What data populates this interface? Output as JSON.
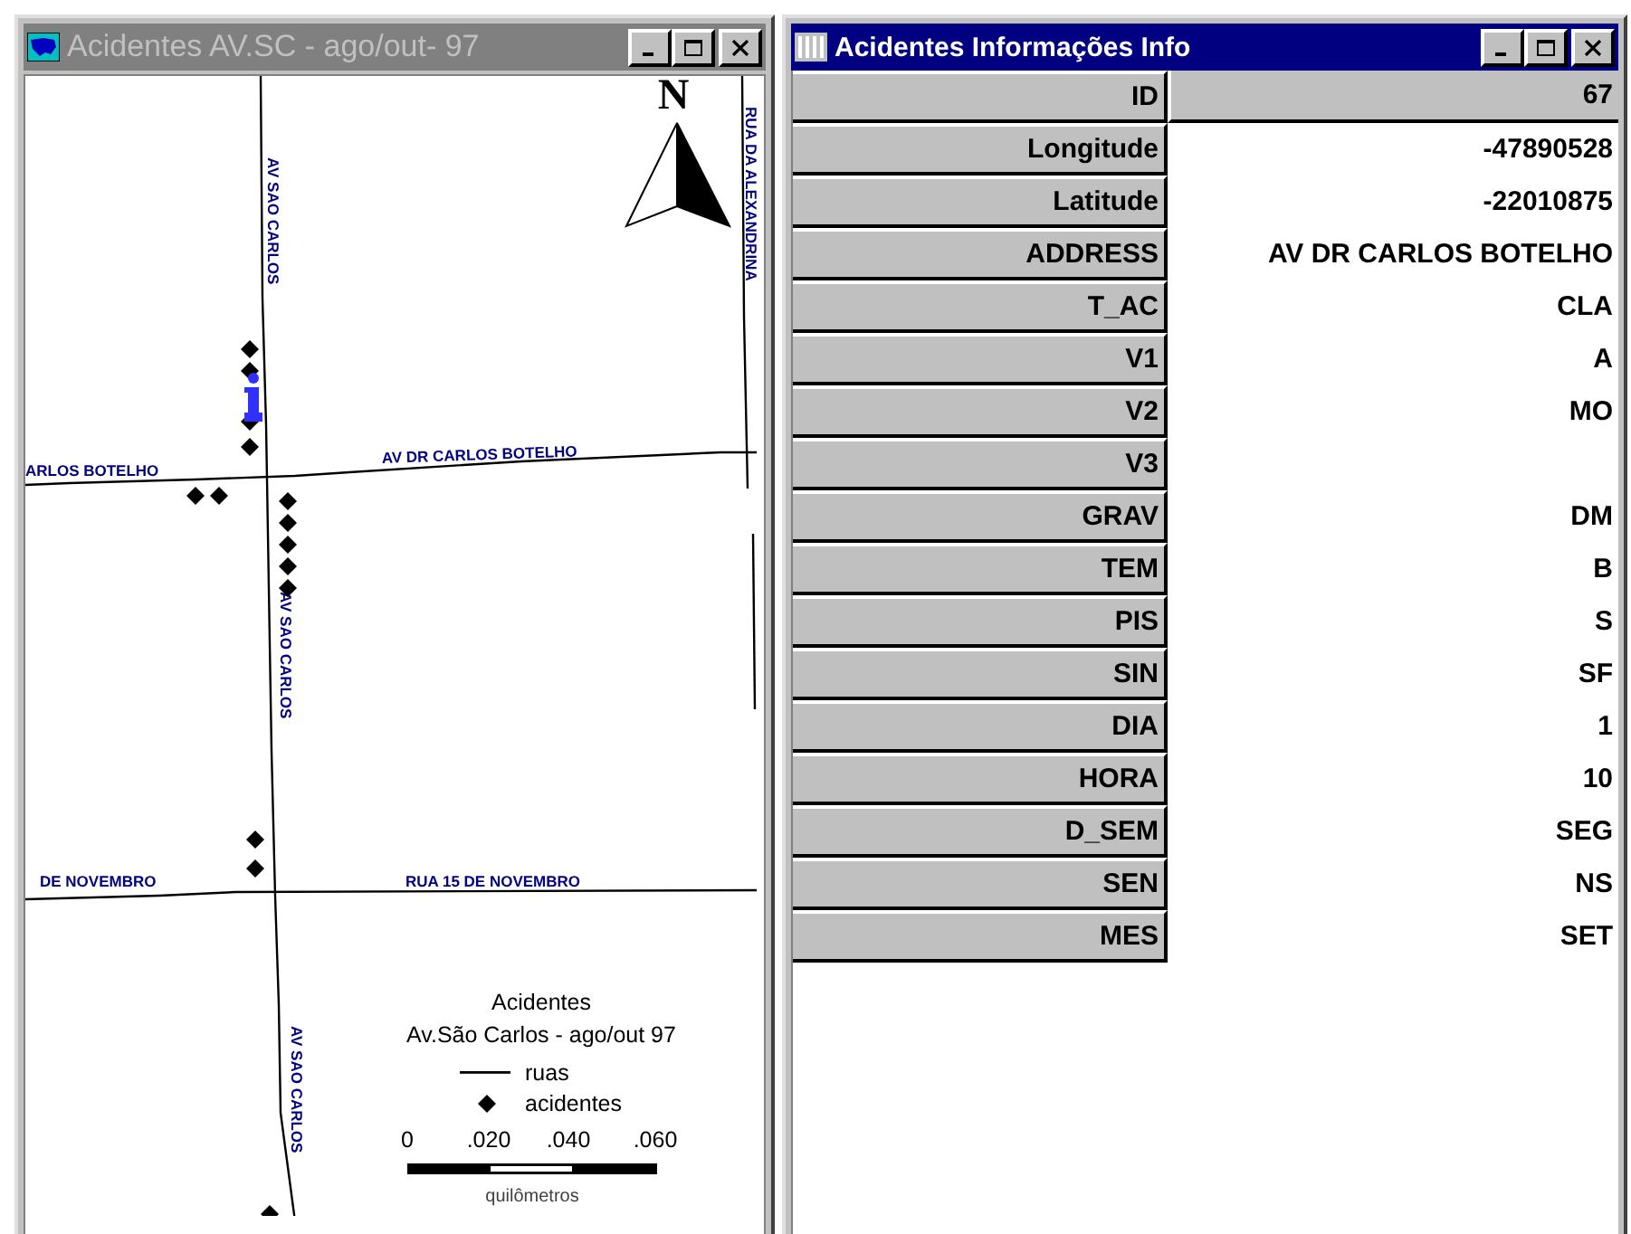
{
  "windows": [
    {
      "kind": "map",
      "title": "Acidentes AV.SC - ago/out- 97",
      "active": false,
      "map": {
        "north": "N",
        "street_labels": [
          {
            "text": "RUA DA ALEXANDRINA",
            "kind": "vertical"
          },
          {
            "text": "AV SAO CARLOS",
            "kind": "vertical"
          },
          {
            "text": "AV DR CARLOS BOTELHO",
            "kind": "horizontal"
          },
          {
            "text": "ARLOS BOTELHO",
            "kind": "horizontal"
          },
          {
            "text": "AV SAO CARLOS",
            "kind": "vertical"
          },
          {
            "text": "DE NOVEMBRO",
            "kind": "horizontal"
          },
          {
            "text": "RUA 15 DE NOVEMBRO",
            "kind": "horizontal"
          },
          {
            "text": "AV SAO CARLOS",
            "kind": "vertical"
          }
        ],
        "legend": {
          "title": "Acidentes",
          "subtitle": "Av.São Carlos - ago/out 97",
          "items": [
            {
              "kind": "line",
              "label": "ruas"
            },
            {
              "kind": "marker",
              "label": "acidentes"
            }
          ],
          "scale_ticks": [
            "0",
            ".020",
            ".040",
            ".060"
          ],
          "scale_unit": "quilômetros"
        }
      }
    },
    {
      "kind": "table",
      "title": "Acidentes Informações Info",
      "active": true,
      "rows": [
        {
          "field": "ID",
          "value": "67",
          "kind": "key"
        },
        {
          "field": "Longitude",
          "value": "-47890528",
          "kind": "field"
        },
        {
          "field": "Latitude",
          "value": "-22010875",
          "kind": "field"
        },
        {
          "field": "ADDRESS",
          "value": "AV DR CARLOS BOTELHO",
          "kind": "field"
        },
        {
          "field": "T_AC",
          "value": "CLA",
          "kind": "field"
        },
        {
          "field": "V1",
          "value": "A",
          "kind": "field"
        },
        {
          "field": "V2",
          "value": "MO",
          "kind": "field"
        },
        {
          "field": "V3",
          "kind": "field"
        },
        {
          "field": "GRAV",
          "value": "DM",
          "kind": "field"
        },
        {
          "field": "TEM",
          "value": "B",
          "kind": "field"
        },
        {
          "field": "PIS",
          "value": "S",
          "kind": "field"
        },
        {
          "field": "SIN",
          "value": "SF",
          "kind": "field"
        },
        {
          "field": "DIA",
          "value": "1",
          "kind": "field"
        },
        {
          "field": "HORA",
          "value": "10",
          "kind": "field"
        },
        {
          "field": "D_SEM",
          "value": "SEG",
          "kind": "field"
        },
        {
          "field": "SEN",
          "value": "NS",
          "kind": "field"
        },
        {
          "field": "MES",
          "value": "SET",
          "kind": "field"
        }
      ]
    }
  ]
}
